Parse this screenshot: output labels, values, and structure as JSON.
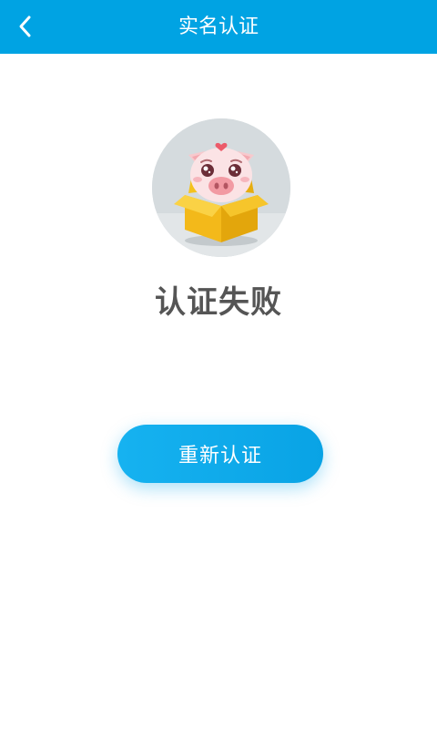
{
  "nav": {
    "title": "实名认证",
    "back_icon": "chevron-left-icon"
  },
  "result": {
    "illustration_icon": "sad-pig-in-box-illustration",
    "status_text": "认证失败"
  },
  "actions": {
    "retry_label": "重新认证"
  },
  "colors": {
    "nav_bar": "#00a3e3",
    "button": "#12adeb",
    "status_text": "#555555",
    "background": "#ffffff"
  }
}
